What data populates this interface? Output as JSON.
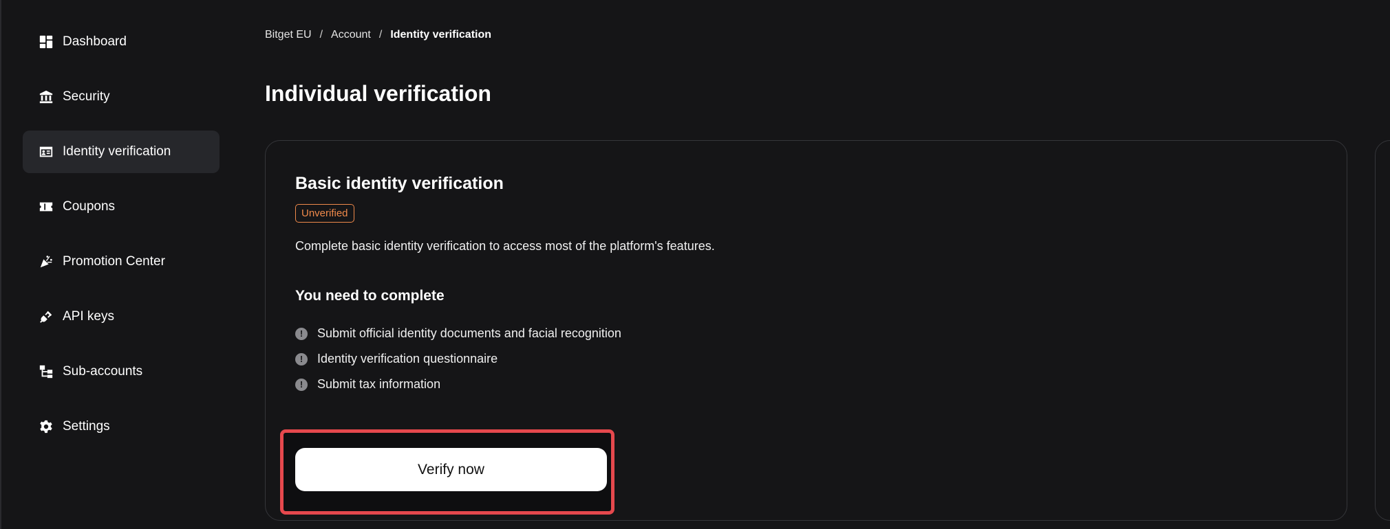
{
  "sidebar": {
    "items": [
      {
        "label": "Dashboard",
        "icon": "dashboard-icon"
      },
      {
        "label": "Security",
        "icon": "bank-icon"
      },
      {
        "label": "Identity verification",
        "icon": "id-card-icon",
        "active": true
      },
      {
        "label": "Coupons",
        "icon": "ticket-icon"
      },
      {
        "label": "Promotion Center",
        "icon": "party-popper-icon"
      },
      {
        "label": "API keys",
        "icon": "plug-icon"
      },
      {
        "label": "Sub-accounts",
        "icon": "hierarchy-icon"
      },
      {
        "label": "Settings",
        "icon": "gear-icon"
      }
    ]
  },
  "breadcrumb": {
    "items": [
      "Bitget EU",
      "Account",
      "Identity verification"
    ],
    "separator": "/"
  },
  "page": {
    "title": "Individual verification"
  },
  "card": {
    "title": "Basic identity verification",
    "status": "Unverified",
    "description": "Complete basic identity verification to access most of the platform's features.",
    "requirements_title": "You need to complete",
    "requirements": [
      "Submit official identity documents and facial recognition",
      "Identity verification questionnaire",
      "Submit tax information"
    ],
    "button_label": "Verify now"
  },
  "colors": {
    "background": "#151517",
    "active_nav": "#26272b",
    "badge": "#f08a4b",
    "highlight": "#e5484d",
    "button": "#ffffff"
  }
}
